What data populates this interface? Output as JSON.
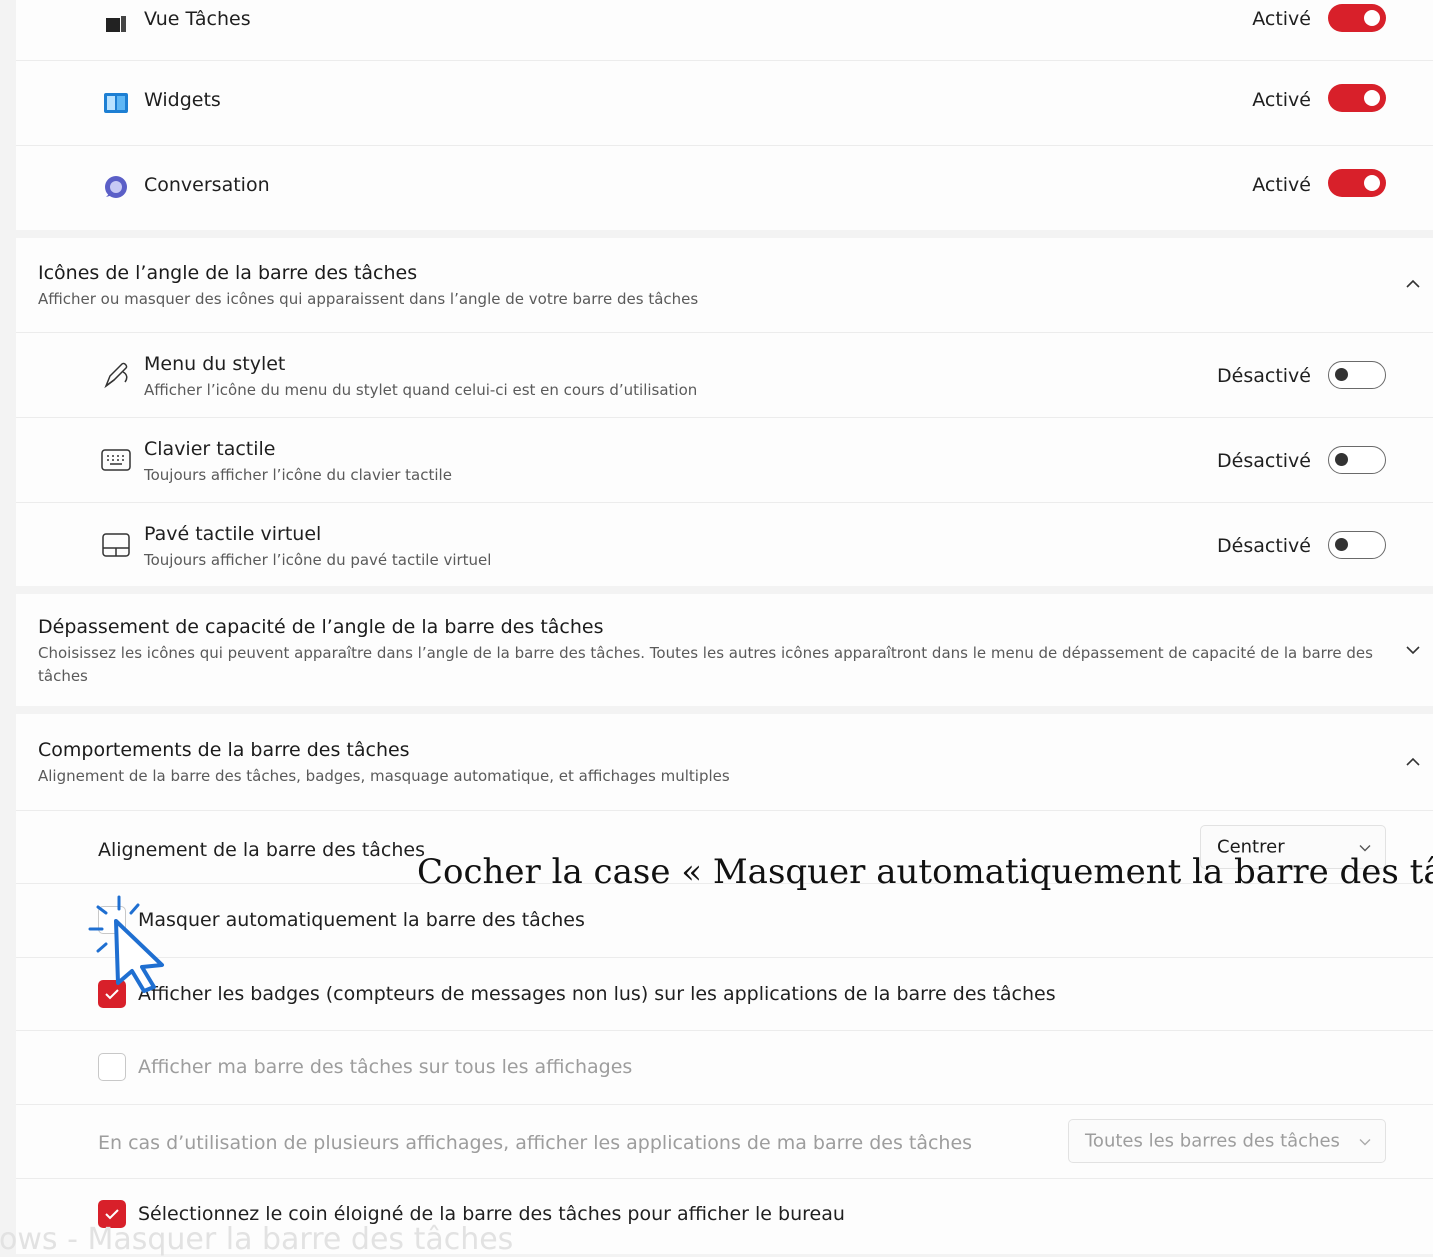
{
  "taskbar_items": [
    {
      "label": "Vue Tâches",
      "state": "Activé",
      "icon": "task-view-icon"
    },
    {
      "label": "Widgets",
      "state": "Activé",
      "icon": "widgets-icon"
    },
    {
      "label": "Conversation",
      "state": "Activé",
      "icon": "chat-icon"
    }
  ],
  "corner_icons": {
    "title": "Icônes de l’angle de la barre des tâches",
    "subtitle": "Afficher ou masquer des icônes qui apparaissent dans l’angle de votre barre des tâches",
    "items": [
      {
        "label": "Menu du stylet",
        "sub": "Afficher l’icône du menu du stylet quand celui-ci est en cours d’utilisation",
        "state": "Désactivé",
        "icon": "pen-icon"
      },
      {
        "label": "Clavier tactile",
        "sub": "Toujours afficher l’icône du clavier tactile",
        "state": "Désactivé",
        "icon": "keyboard-icon"
      },
      {
        "label": "Pavé tactile virtuel",
        "sub": "Toujours afficher l’icône du pavé tactile virtuel",
        "state": "Désactivé",
        "icon": "touchpad-icon"
      }
    ]
  },
  "overflow": {
    "title": "Dépassement de capacité de l’angle de la barre des tâches",
    "subtitle": "Choisissez les icônes qui peuvent apparaître dans l’angle de la barre des tâches. Toutes les autres icônes apparaîtront dans le menu de dépassement de capacité de la barre des tâches"
  },
  "behaviors": {
    "title": "Comportements de la barre des tâches",
    "subtitle": "Alignement de la barre des tâches, badges, masquage automatique, et affichages multiples",
    "alignment_label": "Alignement de la barre des tâches",
    "alignment_value": "Centrer",
    "autohide_label": "Masquer automatiquement la barre des tâches",
    "badges_label": "Afficher les badges (compteurs de messages non lus) sur les applications de la barre des tâches",
    "all_displays_label": "Afficher ma barre des tâches sur tous les affichages",
    "multi_display_label": "En cas d’utilisation de plusieurs affichages, afficher les applications de ma barre des tâches",
    "multi_display_value": "Toutes les barres des tâches",
    "far_corner_label": "Sélectionnez le coin éloigné de la barre des tâches pour afficher le bureau"
  },
  "annotation": "Cocher la case « Masquer automatiquement la barre des tâ",
  "watermark": "dows - Masquer la barre des tâches",
  "colors": {
    "accent": "#d8202a",
    "background": "#f3f3f3",
    "card": "#fdfdfd"
  }
}
